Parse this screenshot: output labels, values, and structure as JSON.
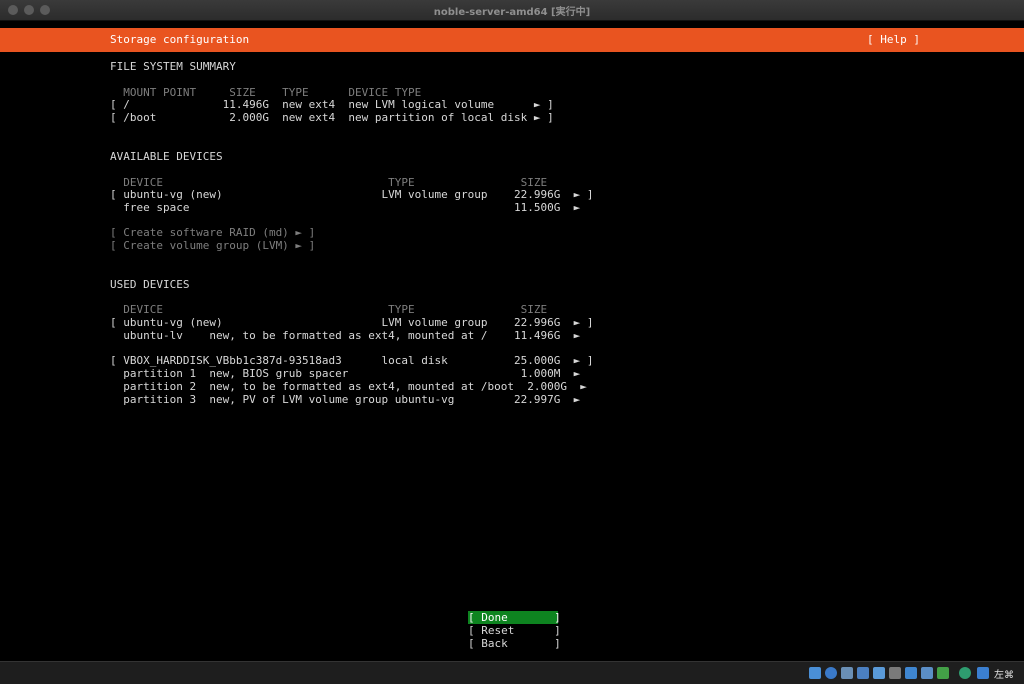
{
  "window": {
    "title": "noble-server-amd64 [実行中]"
  },
  "header": {
    "title": "Storage configuration",
    "help": "[ Help ]"
  },
  "summary": {
    "heading": "FILE SYSTEM SUMMARY",
    "columns": "  MOUNT POINT     SIZE    TYPE      DEVICE TYPE",
    "rows": [
      "[ /              11.496G  new ext4  new LVM logical volume      ► ]",
      "[ /boot           2.000G  new ext4  new partition of local disk ► ]"
    ]
  },
  "available": {
    "heading": "AVAILABLE DEVICES",
    "columns": "  DEVICE                                  TYPE                SIZE",
    "rows": [
      "[ ubuntu-vg (new)                        LVM volume group    22.996G  ► ]",
      "  free space                                                 11.500G  ►"
    ],
    "actions": [
      "[ Create software RAID (md) ► ]",
      "[ Create volume group (LVM) ► ]"
    ]
  },
  "used": {
    "heading": "USED DEVICES",
    "columns": "  DEVICE                                  TYPE                SIZE",
    "rows": [
      "[ ubuntu-vg (new)                        LVM volume group    22.996G  ► ]",
      "  ubuntu-lv    new, to be formatted as ext4, mounted at /    11.496G  ►",
      "[ VBOX_HARDDISK_VBbb1c387d-93518ad3      local disk          25.000G  ► ]",
      "  partition 1  new, BIOS grub spacer                          1.000M  ►",
      "  partition 2  new, to be formatted as ext4, mounted at /boot  2.000G  ►",
      "  partition 3  new, PV of LVM volume group ubuntu-vg         22.997G  ►"
    ]
  },
  "buttons": {
    "done": "[ Done       ]",
    "reset": "[ Reset      ]",
    "back": "[ Back       ]"
  },
  "statusbar": {
    "host_key": "左⌘"
  }
}
